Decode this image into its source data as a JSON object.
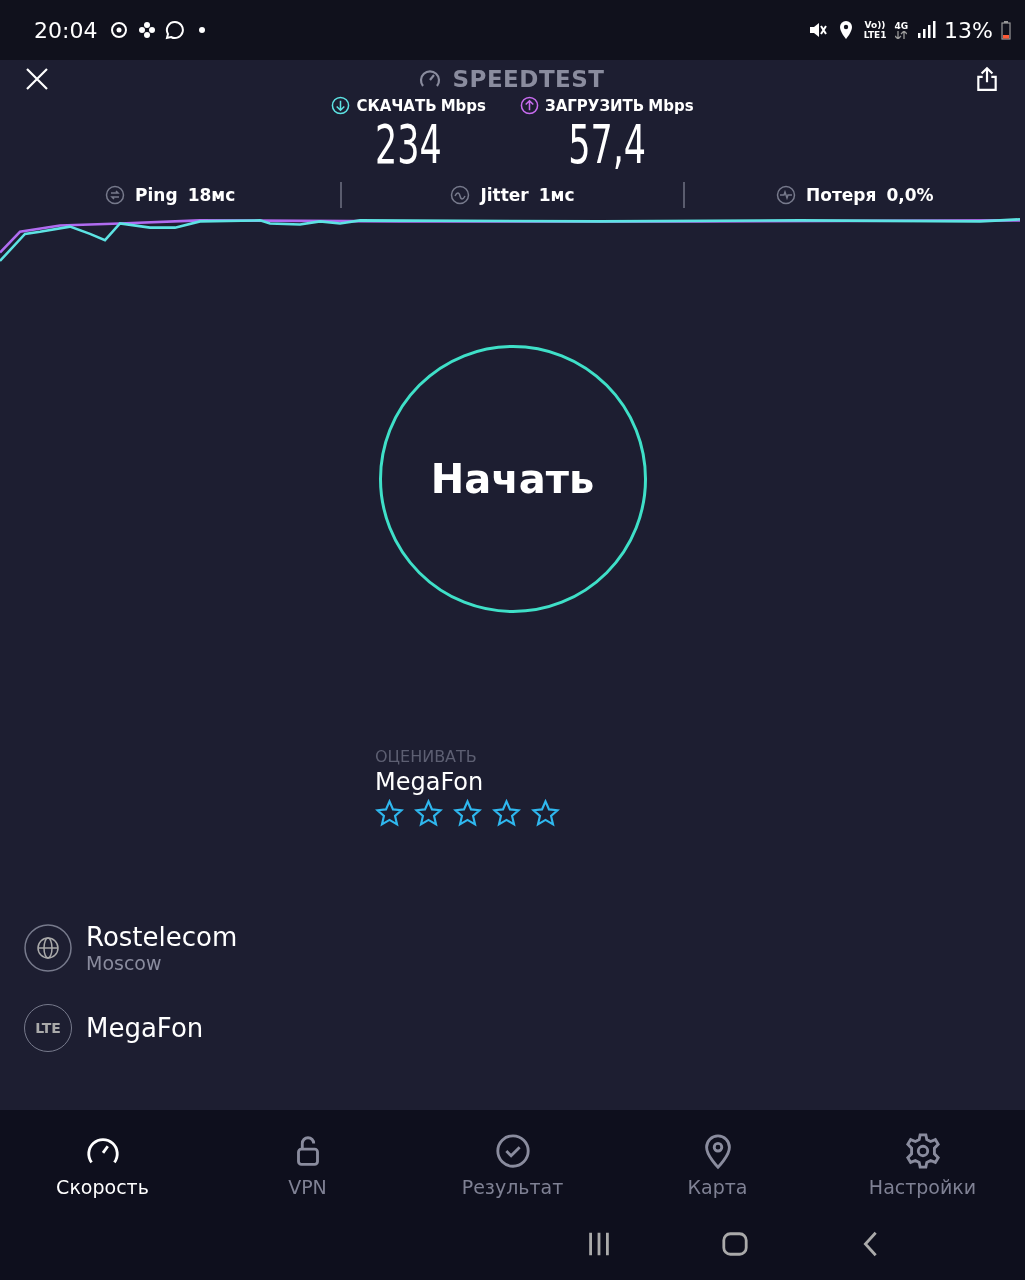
{
  "status_bar": {
    "time": "20:04",
    "volte": "Vo))",
    "lte": "LTE1",
    "network": "4G",
    "battery": "13%"
  },
  "header": {
    "title": "SPEEDTEST"
  },
  "metrics": [
    {
      "kind": "download",
      "label": "СКАЧАТЬ",
      "unit": "Mbps",
      "value": "234"
    },
    {
      "kind": "upload",
      "label": "ЗАГРУЗИТЬ",
      "unit": "Mbps",
      "value": "57,4"
    }
  ],
  "stats": [
    {
      "kind": "ping",
      "label": "Ping",
      "value": "18мс"
    },
    {
      "kind": "jitter",
      "label": "Jitter",
      "value": "1мс"
    },
    {
      "kind": "loss",
      "label": "Потеря",
      "value": "0,0%"
    }
  ],
  "start_button": "Начать",
  "rating": {
    "prompt": "ОЦЕНИВАТЬ",
    "provider": "MegaFon",
    "stars": 0
  },
  "connections": [
    {
      "kind": "server",
      "name": "Rostelecom",
      "location": "Moscow"
    },
    {
      "kind": "network",
      "badge": "LTE",
      "name": "MegaFon"
    }
  ],
  "tabs": [
    {
      "kind": "speed",
      "label": "Скорость",
      "selected": true
    },
    {
      "kind": "vpn",
      "label": "VPN",
      "selected": false
    },
    {
      "kind": "results",
      "label": "Результат",
      "selected": false
    },
    {
      "kind": "map",
      "label": "Карта",
      "selected": false
    },
    {
      "kind": "settings",
      "label": "Настройки",
      "selected": false
    }
  ]
}
